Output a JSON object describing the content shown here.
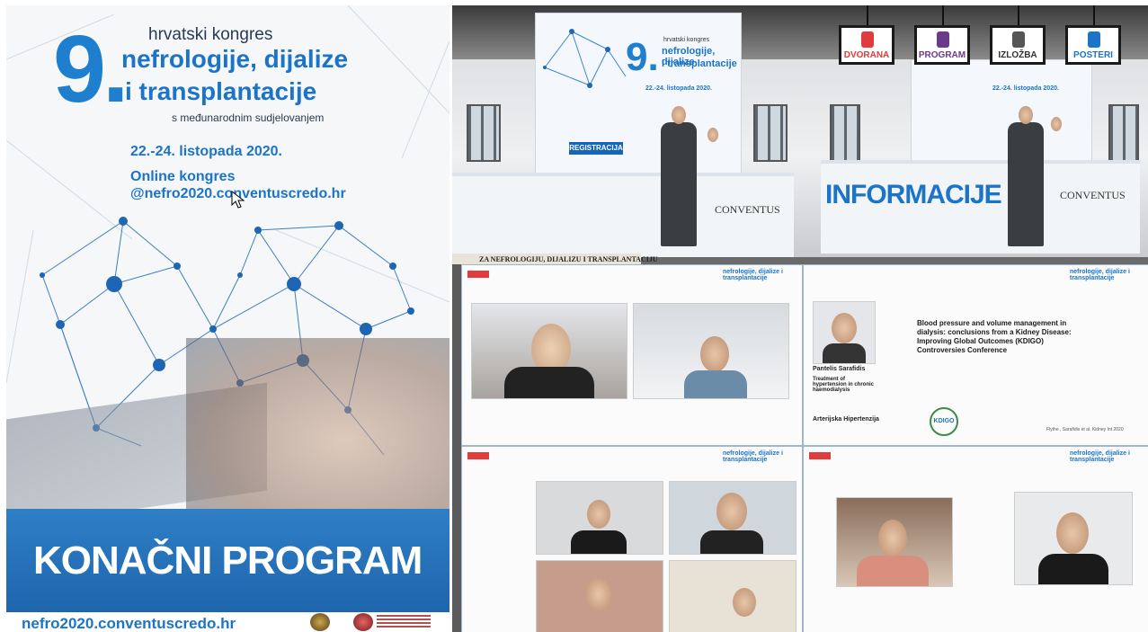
{
  "poster": {
    "number": "9.",
    "kongres": "hrvatski kongres",
    "title_line1": "nefrologije, dijalize",
    "title_line2": "i transplantacije",
    "subtitle": "s međunarodnim sudjelovanjem",
    "dates": "22.-24. listopada 2020.",
    "online": "Online kongres",
    "url": "@nefro2020.conventuscredo.hr",
    "banner": "KONAČNI PROGRAM",
    "footer_url": "nefro2020.conventuscredo.hr"
  },
  "lobby": {
    "registration_button": "REGISTRACIJA",
    "info_sign": "INFORMACIJE",
    "brand": "CONVENTUS",
    "panel_number": "9.",
    "panel_kongres": "hrvatski kongres",
    "panel_line1": "nefrologije, dijalize",
    "panel_line2": "i transplantacije",
    "panel_dates": "22.-24. listopada 2020.",
    "strip_text": "ZA NEFROLOGIJU, DIJALIZU I TRANSPLANTACIJU"
  },
  "nav": [
    {
      "label": "DVORANA",
      "icon": "people-icon",
      "color": "#e23b3b"
    },
    {
      "label": "PROGRAM",
      "icon": "checklist-icon",
      "color": "#6b3a8a"
    },
    {
      "label": "IZLOŽBA",
      "icon": "stand-icon",
      "color": "#555555"
    },
    {
      "label": "POSTERI",
      "icon": "thumbs-up-icon",
      "color": "#1b74c7"
    }
  ],
  "tiles": {
    "tile_logo": "nefrologije, dijalize i transplantacije",
    "speaker_name": "Pantelis Sarafidis",
    "speaker_talk": "Treatment of hypertension in chronic haemodialysis",
    "session": "Arterijska Hipertenzija",
    "slide_title": "Blood pressure and volume management in dialysis: conclusions from a Kidney Disease: Improving Global Outcomes (KDIGO) Controversies Conference",
    "slide_footer": "Flythe , Sarafidis et al. Kidney Int 2020",
    "kdigo": "KDIGO"
  },
  "colors": {
    "brand_blue": "#1b74c7",
    "live_red": "#e23b3b"
  }
}
